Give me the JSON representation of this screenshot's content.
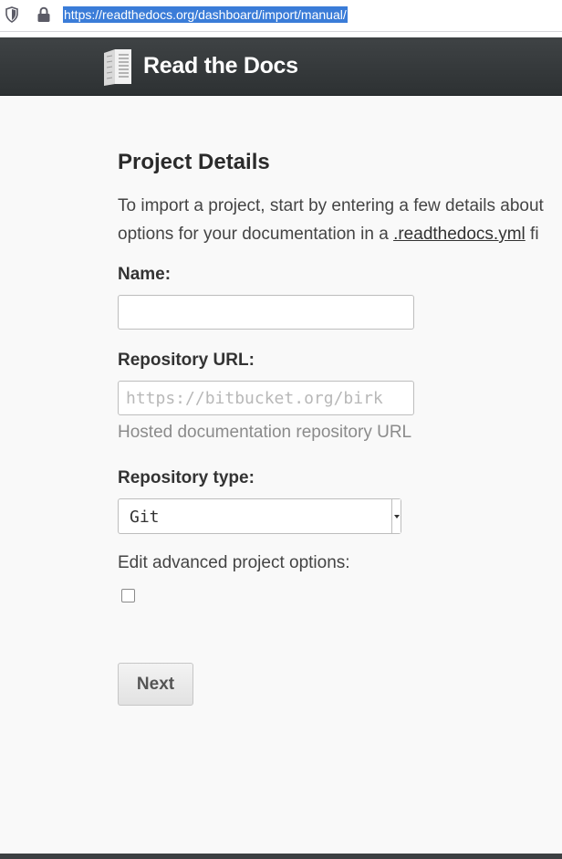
{
  "browser": {
    "url": "https://readthedocs.org/dashboard/import/manual/",
    "icons": [
      "shield-icon",
      "lock-icon"
    ]
  },
  "header": {
    "brand": "Read the Docs",
    "logo_icon": "book-icon",
    "background": "#373b3d"
  },
  "form": {
    "title": "Project Details",
    "intro_line1": "To import a project, start by entering a few details about",
    "intro_line2_prefix": "options for your documentation in a ",
    "intro_link": ".readthedocs.yml",
    "intro_line2_suffix": " fi",
    "name_label": "Name:",
    "name_value": "",
    "repo_url_label": "Repository URL:",
    "repo_url_placeholder": "https://bitbucket.org/birk",
    "repo_url_help": "Hosted documentation repository URL",
    "repo_type_label": "Repository type:",
    "repo_type_value": "Git",
    "advanced_label": "Edit advanced project options:",
    "advanced_checked": false,
    "next_label": "Next"
  }
}
